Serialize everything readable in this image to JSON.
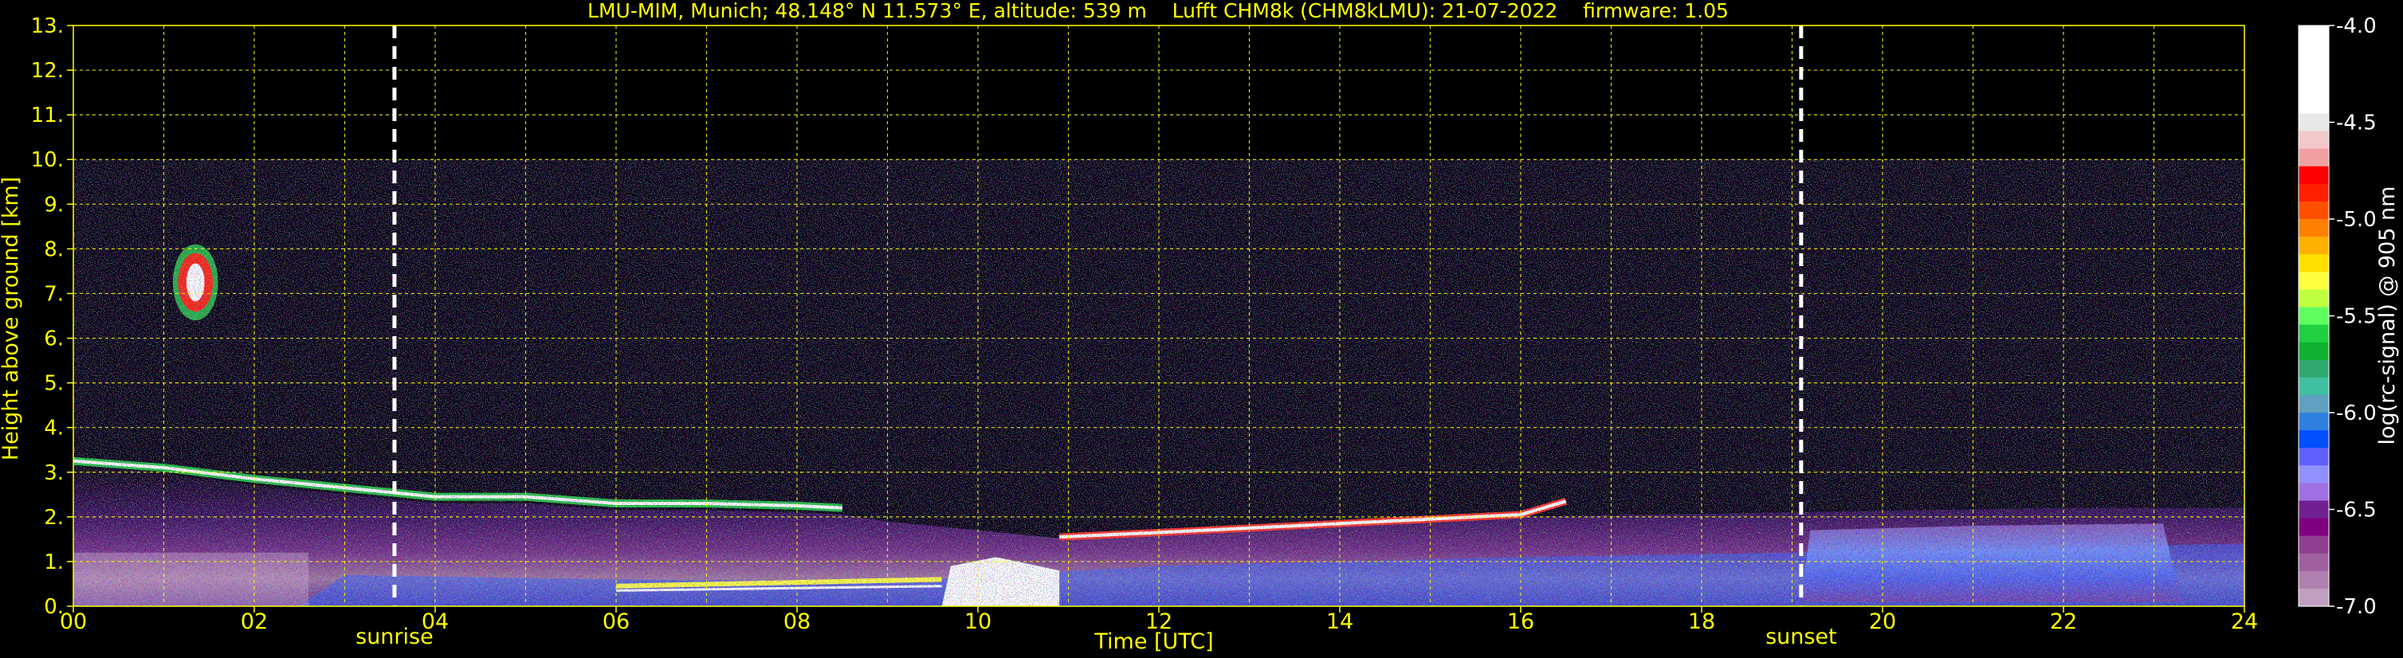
{
  "chart_data": {
    "type": "heatmap",
    "title": "LMU-MIM, Munich; 48.148° N 11.573° E, altitude: 539 m    Lufft CHM8k (CHM8kLMU): 21-07-2022    firmware: 1.05",
    "xlabel": "Time [UTC]",
    "ylabel": "Height above ground [km]",
    "colorbar_label": "log(rc-signal) @ 905 nm",
    "xlim": [
      0,
      24
    ],
    "ylim": [
      0,
      13
    ],
    "clim": [
      -7.0,
      -4.0
    ],
    "x_ticks": [
      "00",
      "02",
      "04",
      "06",
      "08",
      "10",
      "12",
      "14",
      "16",
      "18",
      "20",
      "22",
      "24"
    ],
    "y_ticks": [
      "0.",
      "1.",
      "2.",
      "3.",
      "4.",
      "5.",
      "6.",
      "7.",
      "8.",
      "9.",
      "10.",
      "11.",
      "12.",
      "13."
    ],
    "colorbar_ticks": [
      "-4.0",
      "-4.5",
      "-5.0",
      "-5.5",
      "-6.0",
      "-6.5",
      "-7.0"
    ],
    "colorbar_colors": [
      "#ffffff",
      "#ffffff",
      "#ffffff",
      "#ffffff",
      "#ffffff",
      "#e8e8e8",
      "#f2c8c8",
      "#f0a0a0",
      "#ff0000",
      "#ff2000",
      "#ff5000",
      "#ff8000",
      "#ffb000",
      "#ffe000",
      "#ffff40",
      "#c0ff40",
      "#60ff60",
      "#20d040",
      "#10b030",
      "#30a870",
      "#40c0a0",
      "#60a0c0",
      "#3080e0",
      "#0050ff",
      "#6060ff",
      "#9090ff",
      "#a070e0",
      "#702090",
      "#800080",
      "#904090",
      "#a060a0",
      "#b080b0",
      "#c0a0c0"
    ],
    "grid": true,
    "measurement_top_km": 10,
    "events": [
      {
        "label": "sunrise",
        "time_h": 3.55
      },
      {
        "label": "sunset",
        "time_h": 19.1
      }
    ],
    "layers": {
      "cloud_top_km": [
        {
          "t": 0.0,
          "h": 3.25
        },
        {
          "t": 1.0,
          "h": 3.1
        },
        {
          "t": 2.0,
          "h": 2.85
        },
        {
          "t": 3.0,
          "h": 2.65
        },
        {
          "t": 4.0,
          "h": 2.45
        },
        {
          "t": 5.0,
          "h": 2.45
        },
        {
          "t": 6.0,
          "h": 2.3
        },
        {
          "t": 7.0,
          "h": 2.3
        },
        {
          "t": 8.0,
          "h": 2.25
        },
        {
          "t": 8.5,
          "h": 2.2
        }
      ],
      "cloud_top2_km": [
        {
          "t": 10.9,
          "h": 1.55
        },
        {
          "t": 12.0,
          "h": 1.65
        },
        {
          "t": 13.0,
          "h": 1.75
        },
        {
          "t": 14.0,
          "h": 1.85
        },
        {
          "t": 15.0,
          "h": 1.95
        },
        {
          "t": 16.0,
          "h": 2.05
        },
        {
          "t": 16.5,
          "h": 2.35
        }
      ],
      "cirrus": {
        "t_start": 1.1,
        "t_end": 1.6,
        "h_bottom": 6.4,
        "h_top": 8.1
      },
      "low_cloud_peak": {
        "t_start": 9.6,
        "t_end": 10.9,
        "h_top": 1.1
      }
    }
  }
}
